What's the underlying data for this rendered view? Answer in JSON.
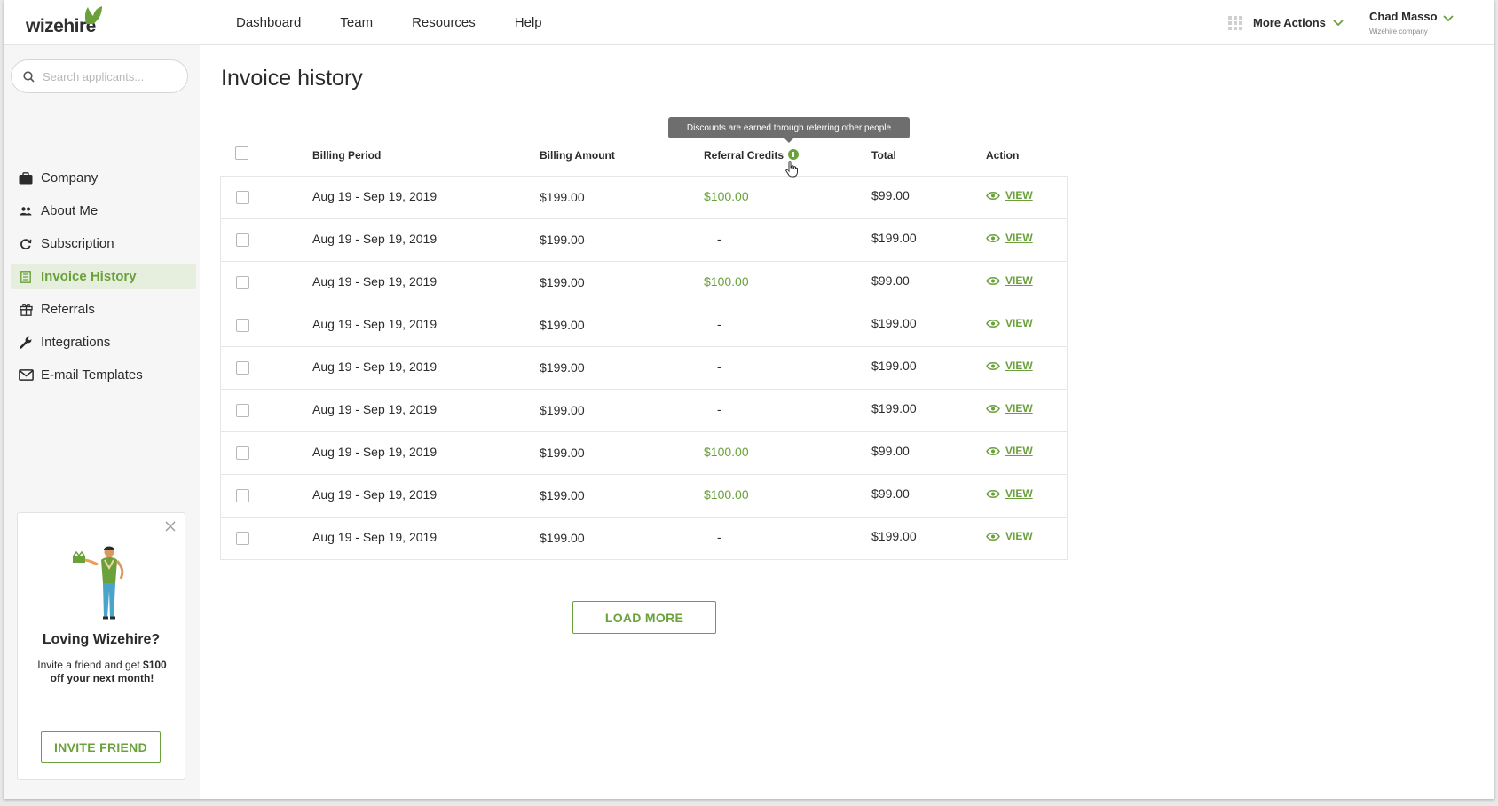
{
  "brand": {
    "logo_text": "wizehire",
    "accent_color": "#6aa13b"
  },
  "nav": {
    "items": [
      {
        "label": "Dashboard"
      },
      {
        "label": "Team"
      },
      {
        "label": "Resources"
      },
      {
        "label": "Help"
      }
    ],
    "more_actions_label": "More Actions"
  },
  "user": {
    "name": "Chad Masso",
    "company": "Wizehire company"
  },
  "search": {
    "placeholder": "Search applicants..."
  },
  "sidebar": {
    "items": [
      {
        "label": "Company",
        "icon": "briefcase-icon"
      },
      {
        "label": "About Me",
        "icon": "people-icon"
      },
      {
        "label": "Subscription",
        "icon": "refresh-icon"
      },
      {
        "label": "Invoice History",
        "icon": "document-icon",
        "active": true
      },
      {
        "label": "Referrals",
        "icon": "gift-icon"
      },
      {
        "label": "Integrations",
        "icon": "wrench-icon"
      },
      {
        "label": "E-mail Templates",
        "icon": "envelope-icon"
      }
    ]
  },
  "promo": {
    "title": "Loving Wizehire?",
    "text_before": "Invite a friend and get ",
    "text_bold": "$100 off your next month!",
    "button_label": "INVITE FRIEND"
  },
  "page": {
    "title": "Invoice history"
  },
  "tooltip": {
    "text": "Discounts are earned through referring other people"
  },
  "table": {
    "columns": {
      "billing_period": "Billing Period",
      "billing_amount": "Billing Amount",
      "referral_credits": "Referral Credits",
      "total": "Total",
      "action": "Action"
    },
    "view_label": "VIEW",
    "rows": [
      {
        "period": "Aug 19 - Sep 19, 2019",
        "amount": "$199.00",
        "credit": "$100.00",
        "total": "$99.00"
      },
      {
        "period": "Aug 19 - Sep 19, 2019",
        "amount": "$199.00",
        "credit": "-",
        "total": "$199.00"
      },
      {
        "period": "Aug 19 - Sep 19, 2019",
        "amount": "$199.00",
        "credit": "$100.00",
        "total": "$99.00"
      },
      {
        "period": "Aug 19 - Sep 19, 2019",
        "amount": "$199.00",
        "credit": "-",
        "total": "$199.00"
      },
      {
        "period": "Aug 19 - Sep 19, 2019",
        "amount": "$199.00",
        "credit": "-",
        "total": "$199.00"
      },
      {
        "period": "Aug 19 - Sep 19, 2019",
        "amount": "$199.00",
        "credit": "-",
        "total": "$199.00"
      },
      {
        "period": "Aug 19 - Sep 19, 2019",
        "amount": "$199.00",
        "credit": "$100.00",
        "total": "$99.00"
      },
      {
        "period": "Aug 19 - Sep 19, 2019",
        "amount": "$199.00",
        "credit": "$100.00",
        "total": "$99.00"
      },
      {
        "period": "Aug 19 - Sep 19, 2019",
        "amount": "$199.00",
        "credit": "-",
        "total": "$199.00"
      }
    ]
  },
  "load_more_label": "LOAD MORE"
}
